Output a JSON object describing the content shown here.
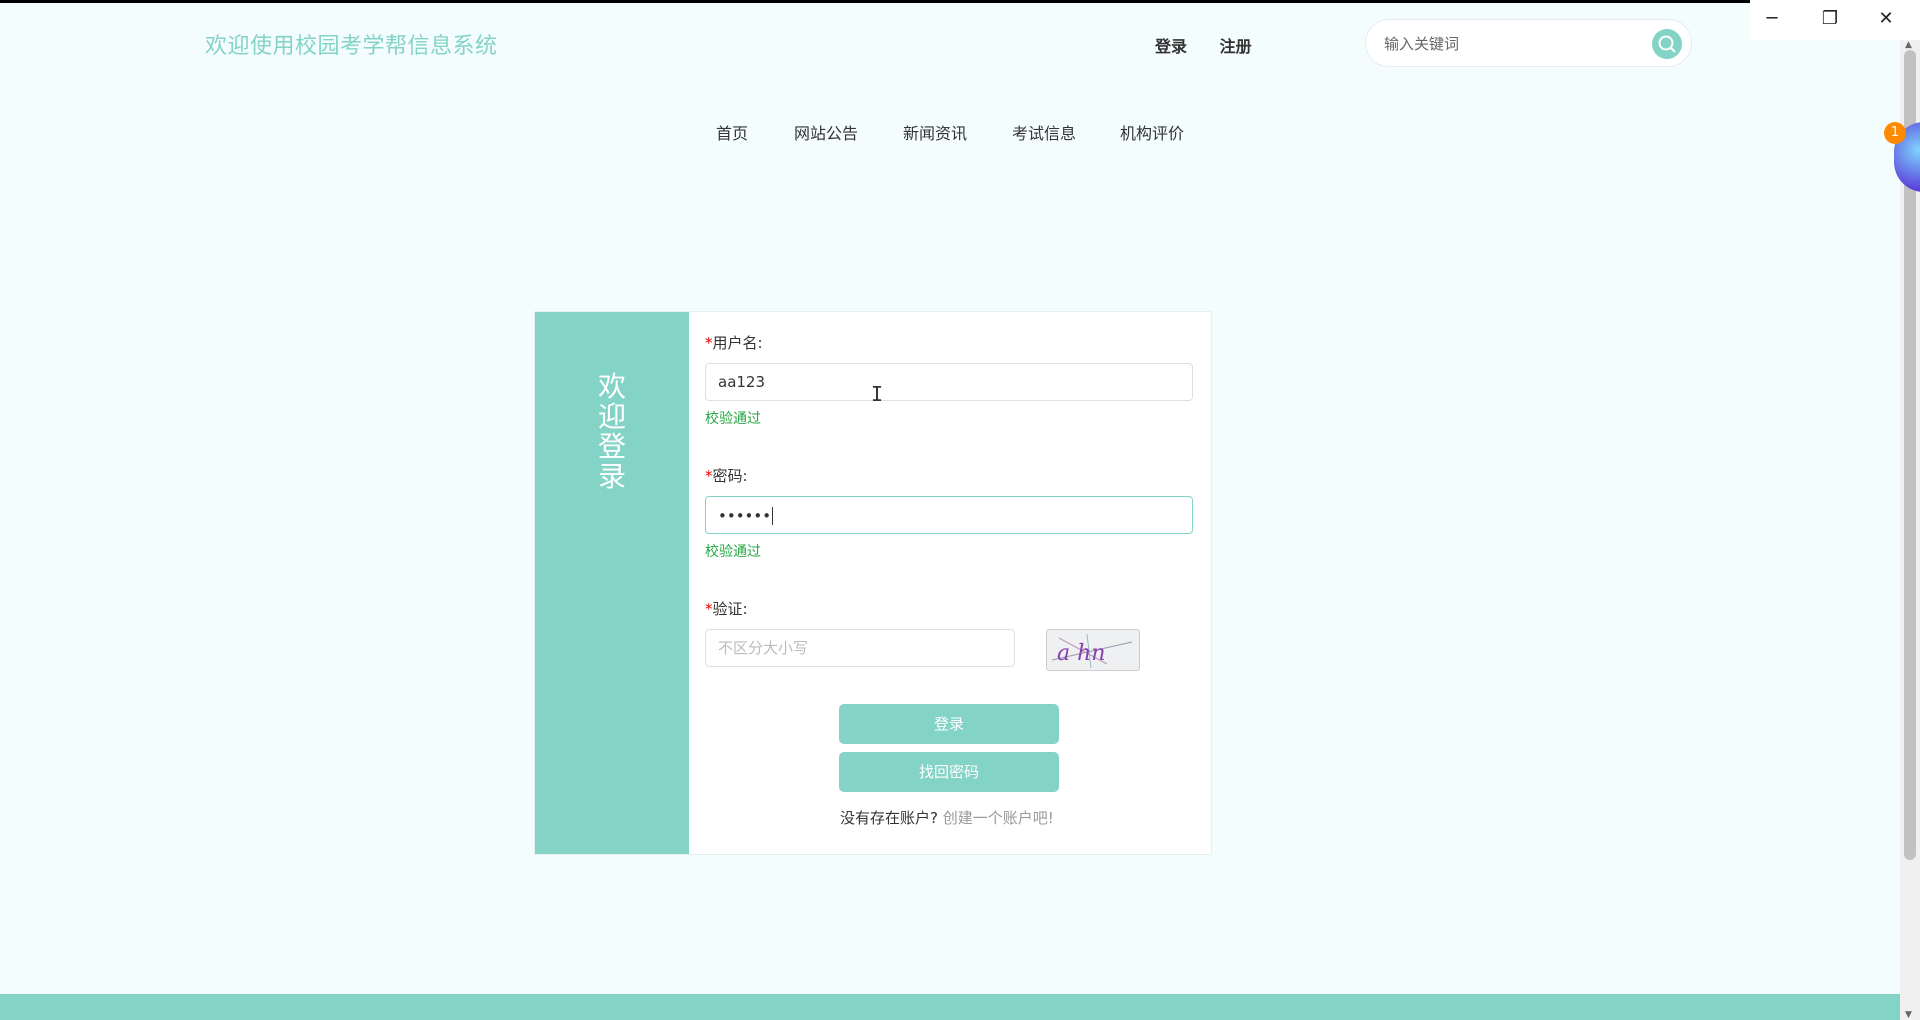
{
  "header": {
    "site_title": "欢迎使用校园考学帮信息系统",
    "login_link": "登录",
    "register_link": "注册",
    "search_placeholder": "输入关键词"
  },
  "nav": {
    "items": [
      "首页",
      "网站公告",
      "新闻资讯",
      "考试信息",
      "机构评价"
    ]
  },
  "login": {
    "side_title": [
      "欢",
      "迎",
      "登",
      "录"
    ],
    "username_label": "用户名:",
    "username_value": "aa123",
    "username_status": "校验通过",
    "password_label": "密码:",
    "password_value": "••••••",
    "password_status": "校验通过",
    "captcha_label": "验证:",
    "captcha_placeholder": "不区分大小写",
    "captcha_text": "a hn",
    "required_mark": "*",
    "login_button": "登录",
    "recover_button": "找回密码",
    "no_account_text": "没有存在账户?",
    "create_account_link": "创建一个账户吧!"
  },
  "widget": {
    "badge_count": "1"
  },
  "colors": {
    "accent": "#84d3c7",
    "valid": "#28a745",
    "required": "#e60000"
  }
}
